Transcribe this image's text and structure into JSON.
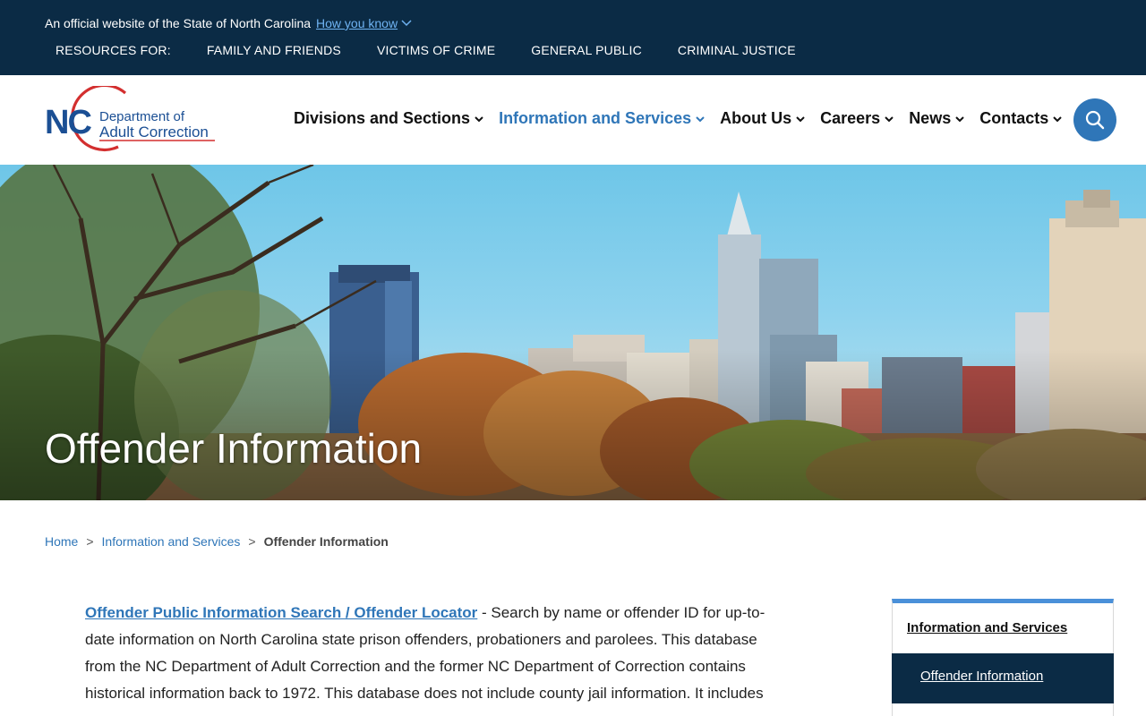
{
  "topbar": {
    "official_text": "An official website of the State of North Carolina",
    "how_you_know": "How you know",
    "resources_label": "RESOURCES FOR:",
    "resources": [
      "FAMILY AND FRIENDS",
      "VICTIMS OF CRIME",
      "GENERAL PUBLIC",
      "CRIMINAL JUSTICE"
    ]
  },
  "logo": {
    "abbr": "NC",
    "line1": "Department of",
    "line2": "Adult Correction"
  },
  "nav": {
    "items": [
      {
        "label": "Divisions and Sections"
      },
      {
        "label": "Information and Services",
        "active": true
      },
      {
        "label": "About Us"
      },
      {
        "label": "Careers"
      },
      {
        "label": "News"
      },
      {
        "label": "Contacts"
      }
    ],
    "search_icon": "search-icon"
  },
  "hero": {
    "title": "Offender Information"
  },
  "breadcrumb": {
    "home": "Home",
    "parent": "Information and Services",
    "current": "Offender Information",
    "separator": ">"
  },
  "main": {
    "link_text": "Offender Public Information Search / Offender Locator",
    "dash": " -  ",
    "paragraph": "Search by name or offender ID for up-to-date information on North Carolina state prison offenders, probationers and parolees. This database from the NC Department of Adult Correction and the former NC Department of Correction contains historical information back to 1972. This database does not include county jail information.  It includes"
  },
  "sidenav": {
    "header": "Information and Services",
    "active_item": "Offender Information"
  },
  "colors": {
    "topbar_bg": "#0b2b45",
    "accent_blue": "#2f76b8",
    "link_light": "#6fb3f2",
    "logo_red": "#d32f2f"
  }
}
